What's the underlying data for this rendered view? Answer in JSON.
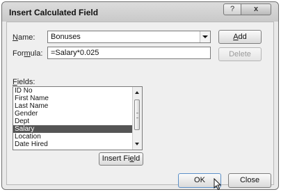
{
  "window": {
    "title": "Insert Calculated Field",
    "help_glyph": "?",
    "close_glyph": "x"
  },
  "name_field": {
    "label_prefix": "N",
    "label_rest": "ame:",
    "value": "Bonuses"
  },
  "formula_field": {
    "label_prefix": "For",
    "label_mnemonic": "m",
    "label_rest": "ula:",
    "value": "=Salary*0.025"
  },
  "buttons": {
    "add_mnemonic": "A",
    "add_rest": "dd",
    "delete": "Delete",
    "insert_field_prefix": "Insert Fi",
    "insert_field_mnemonic": "e",
    "insert_field_rest": "ld",
    "ok": "OK",
    "close": "Close"
  },
  "fields": {
    "label_mnemonic": "F",
    "label_rest": "ields:",
    "items": [
      "ID No",
      "First Name",
      "Last Name",
      "Gender",
      "Dept",
      "Salary",
      "Location",
      "Date Hired"
    ],
    "selected": "Salary"
  }
}
